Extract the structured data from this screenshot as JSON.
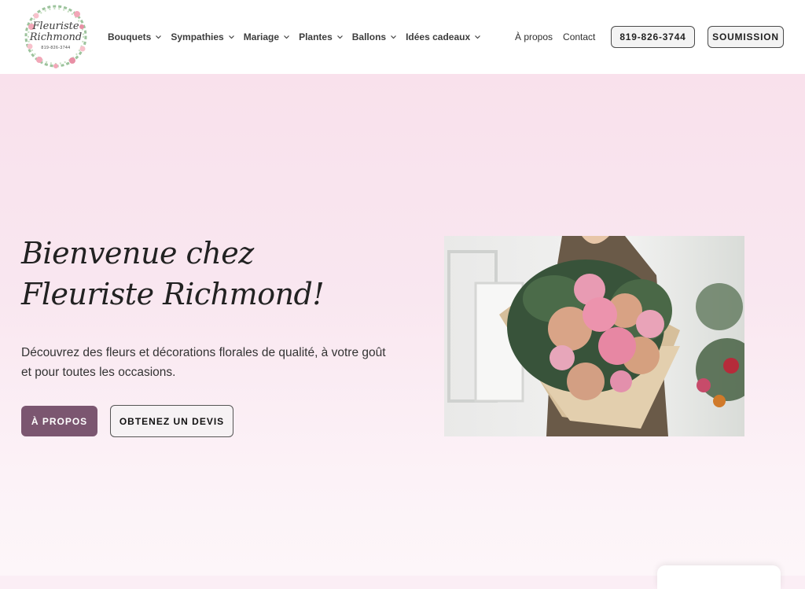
{
  "brand": {
    "logo_line1": "Fleuriste",
    "logo_line2": "Richmond",
    "logo_phone": "819-826-3744"
  },
  "nav": {
    "items": [
      {
        "label": "Bouquets"
      },
      {
        "label": "Sympathies"
      },
      {
        "label": "Mariage"
      },
      {
        "label": "Plantes"
      },
      {
        "label": "Ballons"
      },
      {
        "label": "Idées cadeaux"
      }
    ],
    "about": "À propos",
    "contact": "Contact",
    "phone_button": "819-826-3744",
    "submission_button": "SOUMISSION"
  },
  "hero": {
    "title_line1": "Bienvenue chez",
    "title_line2": "Fleuriste Richmond!",
    "description": "Découvrez des fleurs et décorations florales de qualité, à votre goût et pour toutes les occasions.",
    "primary_button": "À PROPOS",
    "secondary_button": "OBTENEZ UN DEVIS"
  },
  "colors": {
    "primary": "#7b5670",
    "hero_bg": "#f9e1ec"
  },
  "icons": {
    "nav_dropdown": "chevron-down-icon"
  }
}
